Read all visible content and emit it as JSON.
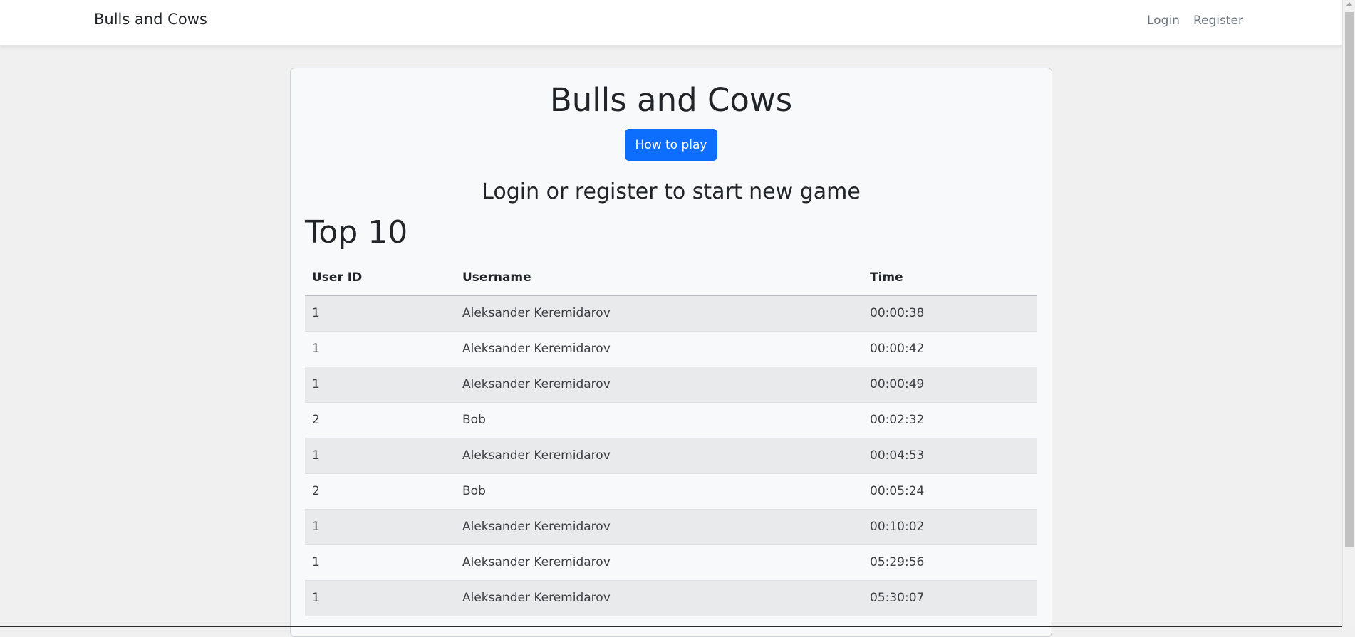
{
  "navbar": {
    "brand": "Bulls and Cows",
    "links": {
      "login": "Login",
      "register": "Register"
    }
  },
  "main": {
    "title": "Bulls and Cows",
    "how_to_play_label": "How to play",
    "subtitle": "Login or register to start new game",
    "top_title": "Top 10",
    "table": {
      "headers": [
        "User ID",
        "Username",
        "Time"
      ],
      "rows": [
        [
          "1",
          "Aleksander Keremidarov",
          "00:00:38"
        ],
        [
          "1",
          "Aleksander Keremidarov",
          "00:00:42"
        ],
        [
          "1",
          "Aleksander Keremidarov",
          "00:00:49"
        ],
        [
          "2",
          "Bob",
          "00:02:32"
        ],
        [
          "1",
          "Aleksander Keremidarov",
          "00:04:53"
        ],
        [
          "2",
          "Bob",
          "00:05:24"
        ],
        [
          "1",
          "Aleksander Keremidarov",
          "00:10:02"
        ],
        [
          "1",
          "Aleksander Keremidarov",
          "05:29:56"
        ],
        [
          "1",
          "Aleksander Keremidarov",
          "05:30:07"
        ]
      ]
    }
  },
  "colors": {
    "primary_button": "#0d6efd",
    "card_background": "#f8f9fa",
    "page_background": "#f0f0f0",
    "striped_row": "#e9eaeb"
  }
}
